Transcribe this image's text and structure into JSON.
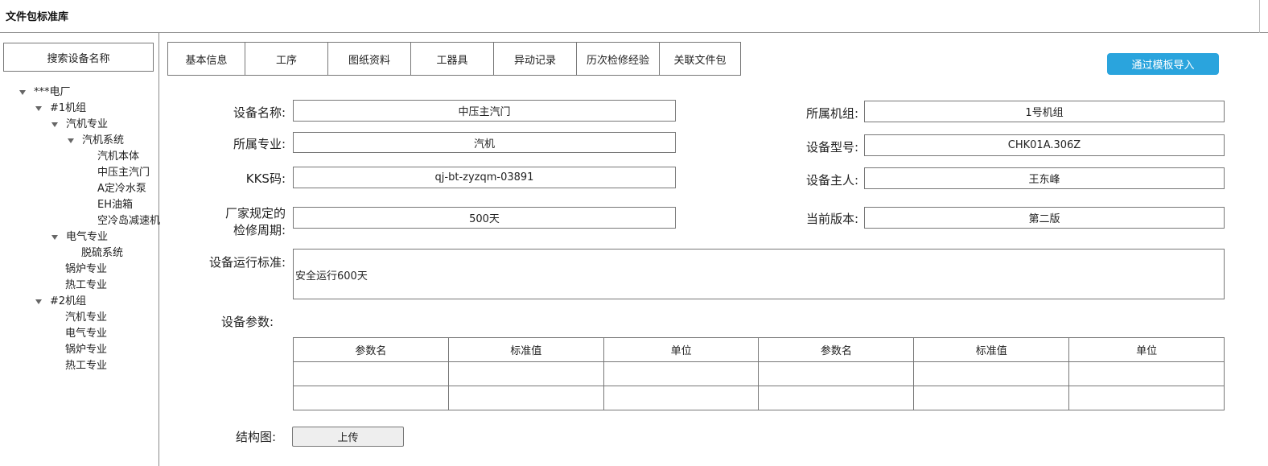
{
  "app": {
    "title": "文件包标准库"
  },
  "sidebar": {
    "search_label": "搜索设备名称",
    "tree": [
      {
        "label": "***电厂",
        "expanded": true
      },
      {
        "label": "#1机组",
        "expanded": true
      },
      {
        "label": "汽机专业",
        "expanded": true
      },
      {
        "label": "汽机系统",
        "expanded": true
      },
      {
        "label": "汽机本体"
      },
      {
        "label": "中压主汽门"
      },
      {
        "label": "A定冷水泵"
      },
      {
        "label": "EH油箱"
      },
      {
        "label": "空冷岛减速机"
      },
      {
        "label": "电气专业",
        "expanded": true
      },
      {
        "label": "脱硫系统"
      },
      {
        "label": "锅炉专业"
      },
      {
        "label": "热工专业"
      },
      {
        "label": "#2机组",
        "expanded": true
      },
      {
        "label": "汽机专业"
      },
      {
        "label": "电气专业"
      },
      {
        "label": "锅炉专业"
      },
      {
        "label": "热工专业"
      }
    ]
  },
  "tabs": [
    {
      "label": "基本信息"
    },
    {
      "label": "工序"
    },
    {
      "label": "图纸资料"
    },
    {
      "label": "工器具"
    },
    {
      "label": "异动记录"
    },
    {
      "label": "历次检修经验"
    },
    {
      "label": "关联文件包"
    }
  ],
  "import_button": "通过模板导入",
  "form": {
    "device_name": {
      "label": "设备名称:",
      "value": "中压主汽门"
    },
    "unit": {
      "label": "所属机组:",
      "value": "1号机组"
    },
    "specialty": {
      "label": "所属专业:",
      "value": "汽机"
    },
    "model": {
      "label": "设备型号:",
      "value": "CHK01A.306Z"
    },
    "kks": {
      "label": "KKS码:",
      "value": "qj-bt-zyzqm-03891"
    },
    "owner": {
      "label": "设备主人:",
      "value": "王东峰"
    },
    "cycle": {
      "label_line1": "厂家规定的",
      "label_line2": "检修周期:",
      "value": "500天"
    },
    "version": {
      "label": "当前版本:",
      "value": "第二版"
    },
    "standard": {
      "label": "设备运行标准:",
      "value": "安全运行600天"
    },
    "params_label": "设备参数:",
    "structure_label": "结构图:",
    "upload_button": "上传"
  },
  "params_table": {
    "headers": [
      "参数名",
      "标准值",
      "单位",
      "参数名",
      "标准值",
      "单位"
    ],
    "rows": [
      [
        "",
        "",
        "",
        "",
        "",
        ""
      ],
      [
        "",
        "",
        "",
        "",
        "",
        ""
      ]
    ]
  },
  "colors": {
    "accent": "#2aa4dd",
    "border": "#777777"
  }
}
